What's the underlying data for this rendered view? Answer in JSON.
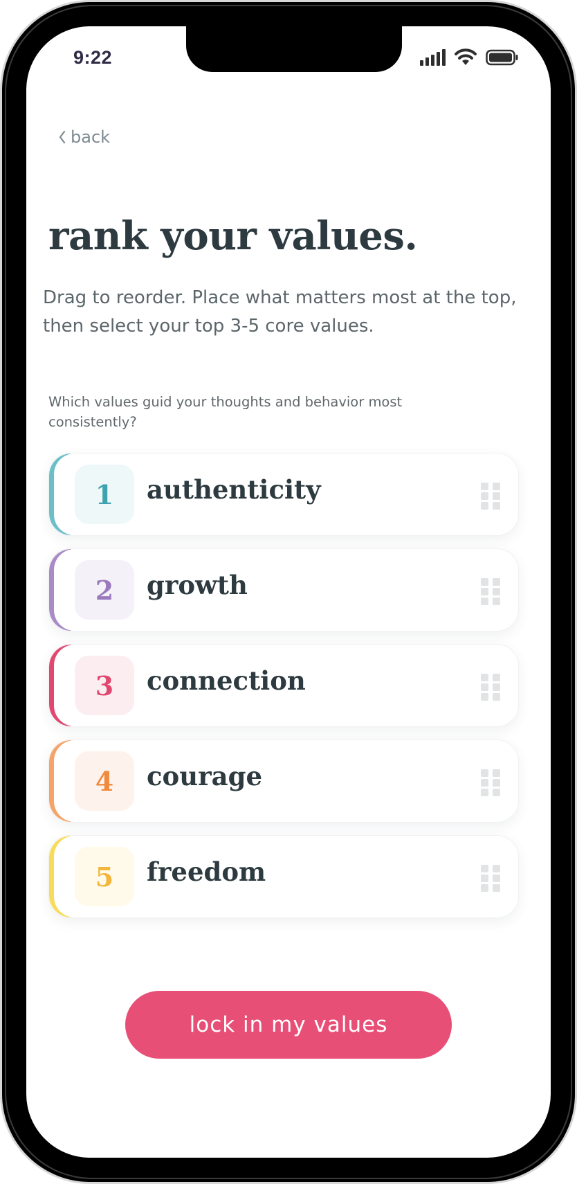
{
  "status_bar": {
    "time": "9:22"
  },
  "nav": {
    "back_label": "back"
  },
  "header": {
    "title": "rank your values.",
    "subtitle": "Drag to reorder. Place what matters most at the top, then select your top 3-5 core values."
  },
  "prompt": {
    "question": "Which values guid your thoughts and behavior most consistently?"
  },
  "values": [
    {
      "rank": "1",
      "label": "authenticity",
      "accent": "#6bbfc8",
      "badge_bg": "#eef8f9",
      "number_color": "#3ea3ae"
    },
    {
      "rank": "2",
      "label": "growth",
      "accent": "#a98bc7",
      "badge_bg": "#f5f1f9",
      "number_color": "#9a79bd"
    },
    {
      "rank": "3",
      "label": "connection",
      "accent": "#e0486f",
      "badge_bg": "#fcedf1",
      "number_color": "#e0486f"
    },
    {
      "rank": "4",
      "label": "courage",
      "accent": "#f6a36a",
      "badge_bg": "#fef3ec",
      "number_color": "#f08a3c"
    },
    {
      "rank": "5",
      "label": "freedom",
      "accent": "#f8db5a",
      "badge_bg": "#fffaea",
      "number_color": "#f3b63a"
    }
  ],
  "actions": {
    "primary_label": "lock in my values",
    "primary_color": "#e84f77"
  },
  "icons": {
    "back": "chevron-left-icon",
    "signal": "cellular-signal-icon",
    "wifi": "wifi-icon",
    "battery": "battery-icon",
    "drag": "drag-handle-icon"
  }
}
